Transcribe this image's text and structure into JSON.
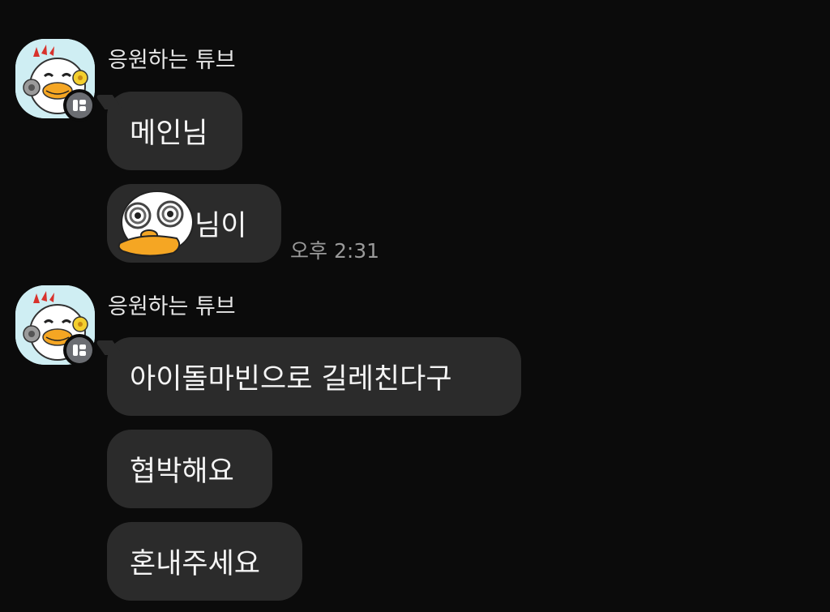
{
  "groups": [
    {
      "sender": "응원하는 튜브",
      "messages": [
        {
          "text": "메인님"
        },
        {
          "text": "님이",
          "has_emoticon": true,
          "timestamp": "오후 2:31"
        }
      ]
    },
    {
      "sender": "응원하는 튜브",
      "messages": [
        {
          "text": "아이돌마빈으로 길레친다구"
        },
        {
          "text": "협박해요"
        },
        {
          "text": "혼내주세요"
        }
      ]
    }
  ],
  "colors": {
    "background": "#0b0b0b",
    "bubble": "#2b2b2b",
    "text": "#f4f4f4",
    "timestamp": "#9a9a9a",
    "avatar_bg": "#cfeef3"
  },
  "icons": [
    "tube-duck-avatar",
    "kakao-profile-badge-icon",
    "tube-duck-emoticon"
  ]
}
